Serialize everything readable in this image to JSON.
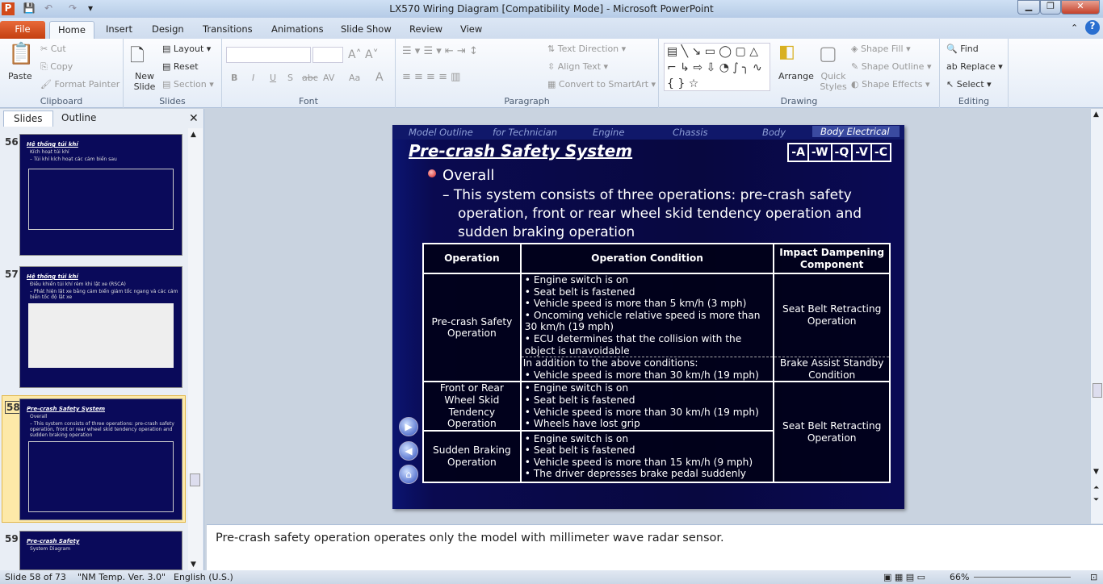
{
  "window": {
    "title": "LX570 Wiring Diagram [Compatibility Mode]  -  Microsoft PowerPoint",
    "controls": [
      "minimize",
      "restore",
      "close"
    ]
  },
  "tabs": [
    "File",
    "Home",
    "Insert",
    "Design",
    "Transitions",
    "Animations",
    "Slide Show",
    "Review",
    "View"
  ],
  "ribbon": {
    "clipboard": {
      "label": "Clipboard",
      "paste": "Paste",
      "cut": "Cut",
      "copy": "Copy",
      "format_painter": "Format Painter"
    },
    "slides": {
      "label": "Slides",
      "new_slide": "New Slide",
      "layout": "Layout",
      "reset": "Reset",
      "section": "Section"
    },
    "font": {
      "label": "Font",
      "font_name": "",
      "font_size": "",
      "bold": "B",
      "italic": "I",
      "underline": "U",
      "shadow": "S",
      "strike": "abc",
      "spacing": "AV",
      "case": "Aa",
      "color": "A"
    },
    "paragraph": {
      "label": "Paragraph",
      "text_direction": "Text Direction",
      "align_text": "Align Text",
      "convert": "Convert to SmartArt"
    },
    "drawing": {
      "label": "Drawing",
      "arrange": "Arrange",
      "quick_styles": "Quick Styles",
      "shape_fill": "Shape Fill",
      "shape_outline": "Shape Outline",
      "shape_effects": "Shape Effects"
    },
    "editing": {
      "label": "Editing",
      "find": "Find",
      "replace": "Replace",
      "select": "Select"
    }
  },
  "left_pane": {
    "tabs": [
      "Slides",
      "Outline"
    ],
    "thumbs": [
      {
        "num": "56",
        "title": "Hệ thống túi khí",
        "lines": [
          "Kích hoạt túi khí",
          "– Túi khí kích hoạt các cảm biến sau"
        ]
      },
      {
        "num": "57",
        "title": "Hệ thống túi khí",
        "lines": [
          "Điều khiển túi khí rèm khi lật xe (RSCA)",
          "– Phát hiện lật xe bằng cảm biến giảm tốc ngang và các cảm biến tốc độ lật xe"
        ]
      },
      {
        "num": "58",
        "title": "Pre-crash Safety System",
        "lines": [
          "Overall",
          "– This system consists of three operations: pre-crash safety operation, front or rear wheel skid tendency operation and sudden braking operation"
        ]
      },
      {
        "num": "59",
        "title": "Pre-crash Safety",
        "lines": [
          "System Diagram"
        ]
      }
    ]
  },
  "slide": {
    "nav": [
      "Model Outline",
      "for Technician",
      "Engine",
      "Chassis",
      "Body",
      "Body Electrical"
    ],
    "title": "Pre-crash Safety System",
    "codes": [
      "-A",
      "-W",
      "-Q",
      "-V",
      "-C"
    ],
    "bullet": "Overall",
    "description": "– This system consists of three operations: pre-crash safety operation, front or rear wheel skid tendency operation and sudden braking operation",
    "table": {
      "headers": [
        "Operation",
        "Operation Condition",
        "Impact Dampening Component"
      ],
      "r1": {
        "op": "Pre-crash Safety Operation",
        "cond": [
          "Engine switch is on",
          "Seat belt is fastened",
          "Vehicle speed is more than 5 km/h (3 mph)",
          "Oncoming vehicle relative speed is more than 30 km/h (19 mph)",
          "ECU determines that the collision with the object is unavoidable"
        ],
        "comp": "Seat Belt Retracting Operation"
      },
      "r1b": {
        "intro": "In addition to the above conditions:",
        "cond": [
          "Vehicle speed is more than 30 km/h (19 mph)"
        ],
        "comp": "Brake Assist Standby Condition"
      },
      "r2": {
        "op": "Front or Rear Wheel Skid Tendency Operation",
        "cond": [
          "Engine switch is on",
          "Seat belt is fastened",
          "Vehicle speed is more than 30 km/h (19 mph)",
          "Wheels have lost grip"
        ],
        "comp": "Seat Belt Retracting Operation"
      },
      "r3": {
        "op": "Sudden Braking Operation",
        "cond": [
          "Engine switch is on",
          "Seat belt is fastened",
          "Vehicle speed is more than 15 km/h (9 mph)",
          "The driver depresses brake pedal suddenly"
        ]
      }
    }
  },
  "notes": "Pre-crash safety operation operates only the model with millimeter wave radar sensor.",
  "status": {
    "slide": "Slide 58 of 73",
    "theme": "\"NM Temp. Ver. 3.0\"",
    "language": "English (U.S.)",
    "zoom": "66%"
  },
  "colors": {
    "slide_bg": "#080840",
    "file_tab": "#d04a1a"
  }
}
